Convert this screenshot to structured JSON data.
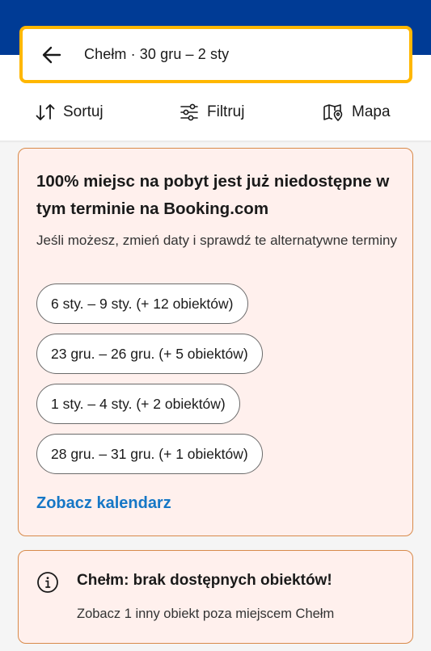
{
  "header": {
    "search_text": "Chełm · 30 gru – 2 sty",
    "brand_color": "#003b95",
    "focus_color": "#ffb700"
  },
  "toolbar": {
    "sort_label": "Sortuj",
    "filter_label": "Filtruj",
    "map_label": "Mapa"
  },
  "availability": {
    "title": "100% miejsc na pobyt jest już niedostępne w tym terminie na Booking.com",
    "subtitle": "Jeśli możesz, zmień daty i sprawdź te alternatywne terminy",
    "alternatives": [
      "6 sty. – 9 sty. (+ 12 obiektów)",
      "23 gru. – 26 gru. (+ 5 obiektów)",
      "1 sty. – 4 sty. (+ 2 obiektów)",
      "28 gru. – 31 gru. (+ 1 obiektów)"
    ],
    "calendar_link": "Zobacz kalendarz"
  },
  "no_results": {
    "icon": "info-icon",
    "title": "Chełm: brak dostępnych obiektów!",
    "subtitle": "Zobacz 1 inny obiekt poza miejscem Chełm"
  }
}
